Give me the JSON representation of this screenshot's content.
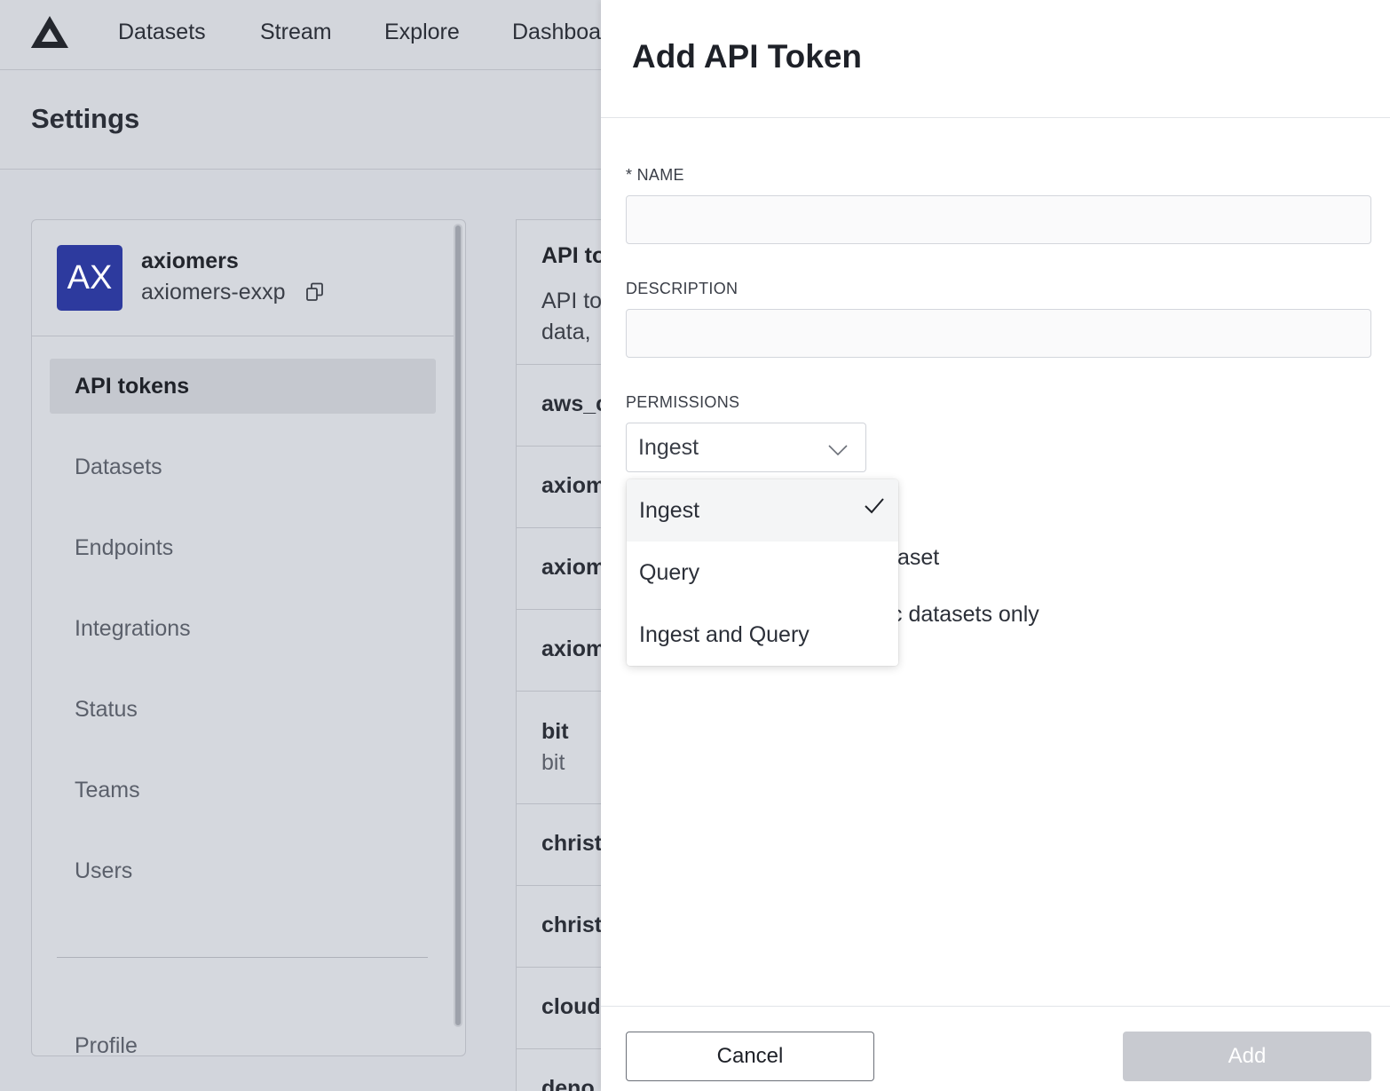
{
  "nav": {
    "items": [
      "Datasets",
      "Stream",
      "Explore",
      "Dashboa"
    ]
  },
  "settings": {
    "title": "Settings"
  },
  "org": {
    "avatar_initials": "AX",
    "name": "axiomers",
    "id": "axiomers-exxp"
  },
  "sidebar": {
    "items": [
      {
        "label": "API tokens",
        "active": true
      },
      {
        "label": "Datasets"
      },
      {
        "label": "Endpoints"
      },
      {
        "label": "Integrations"
      },
      {
        "label": "Status"
      },
      {
        "label": "Teams"
      },
      {
        "label": "Users"
      },
      {
        "label": "Profile"
      }
    ]
  },
  "tokens_panel": {
    "title": "API to",
    "desc_line1": "API to",
    "desc_line2": "data,",
    "rows": [
      {
        "name": "aws_c"
      },
      {
        "name": "axiom"
      },
      {
        "name": "axiom"
      },
      {
        "name": "axiom"
      },
      {
        "name": "bit",
        "sub": "bit"
      },
      {
        "name": "christ"
      },
      {
        "name": "christ"
      },
      {
        "name": "cloud"
      },
      {
        "name": "deno"
      }
    ]
  },
  "modal": {
    "title": "Add API Token",
    "name_label": "* NAME",
    "name_value": "",
    "description_label": "DESCRIPTION",
    "description_value": "",
    "permissions_label": "PERMISSIONS",
    "permissions_selected": "Ingest",
    "partial_option_1": "taset",
    "partial_option_2": "c datasets only",
    "dropdown_options": [
      "Ingest",
      "Query",
      "Ingest and Query"
    ],
    "cancel_label": "Cancel",
    "add_label": "Add"
  },
  "colors": {
    "avatar": "#2d3a9e",
    "overlay_bg": "#d2d5dc",
    "add_disabled": "#c8cad0"
  }
}
